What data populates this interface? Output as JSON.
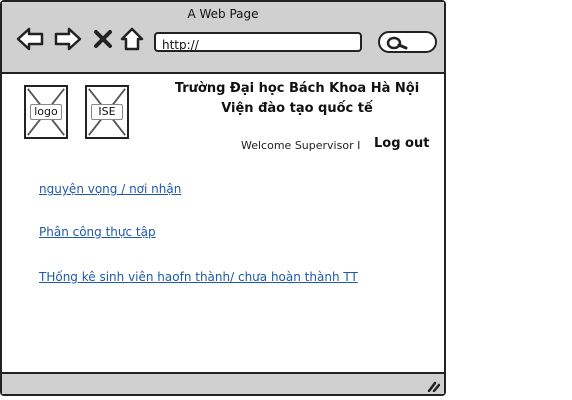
{
  "window": {
    "title": "A Web Page"
  },
  "toolbar": {
    "back_icon": "arrow-left-icon",
    "forward_icon": "arrow-right-icon",
    "stop_icon": "close-icon",
    "home_icon": "home-icon",
    "address_value": "http://",
    "search_icon": "search-icon"
  },
  "header": {
    "logo_label": "logo",
    "ise_label": "ISE",
    "university": "Trường Đại học Bách Khoa Hà Nội",
    "institute": "Viện đào tạo quốc tế",
    "welcome": "Welcome Supervisor I",
    "logout": "Log out"
  },
  "links": [
    " nguyện vọng / nơi nhận",
    "Phân công thực tập",
    "THống kê sinh viên haofn thành/ chưa hoàn thành TT"
  ],
  "colors": {
    "chrome": "#d0d0d0",
    "link": "#1e5aa8",
    "border": "#222222"
  }
}
